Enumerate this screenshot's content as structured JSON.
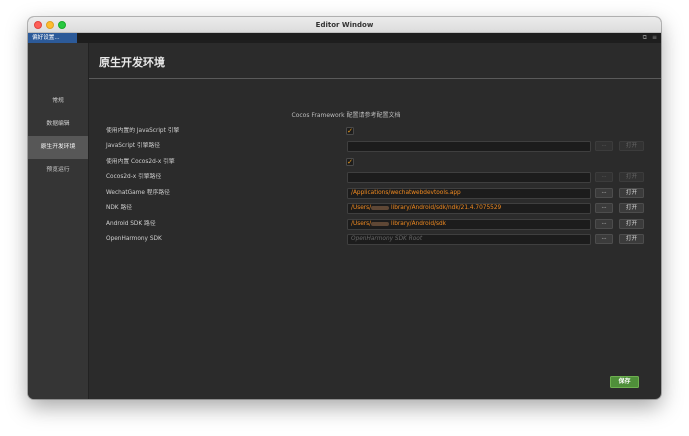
{
  "window": {
    "title": "Editor Window"
  },
  "tab": {
    "label": "偏好设置..."
  },
  "sidebar": {
    "items": [
      {
        "label": "常规"
      },
      {
        "label": "数据编辑"
      },
      {
        "label": "原生开发环境"
      },
      {
        "label": "预览运行"
      }
    ],
    "active_index": 2
  },
  "main": {
    "title": "原生开发环境",
    "hint": "Cocos Framework 配置请参考配置文档",
    "rows": [
      {
        "label": "使用内置的 JavaScript 引擎",
        "type": "checkbox",
        "checked": true
      },
      {
        "label": "JavaScript 引擎路径",
        "type": "path",
        "value": "",
        "placeholder": "",
        "enabled": false
      },
      {
        "label": "使用内置 Cocos2d-x 引擎",
        "type": "checkbox",
        "checked": true
      },
      {
        "label": "Cocos2d-x 引擎路径",
        "type": "path",
        "value": "",
        "placeholder": "",
        "enabled": false
      },
      {
        "label": "WechatGame 程序路径",
        "type": "path",
        "value": "/Applications/wechatwebdevtools.app",
        "enabled": true
      },
      {
        "label": "NDK 路径",
        "type": "path",
        "value_prefix": "/Users/",
        "value_suffix": "library/Android/sdk/ndk/21.4.7075529",
        "enabled": true
      },
      {
        "label": "Android SDK 路径",
        "type": "path",
        "value_prefix": "/Users/",
        "value_suffix": "library/Android/sdk",
        "enabled": true
      },
      {
        "label": "OpenHarmony SDK",
        "type": "path",
        "value": "",
        "placeholder": "OpenHarmony SDK Root",
        "enabled": true
      }
    ],
    "browse_label": "···",
    "open_label": "打开",
    "save_label": "保存"
  },
  "colors": {
    "accent": "#f08a20",
    "save": "#4f8f3a",
    "tab_active": "#2c5a99"
  }
}
